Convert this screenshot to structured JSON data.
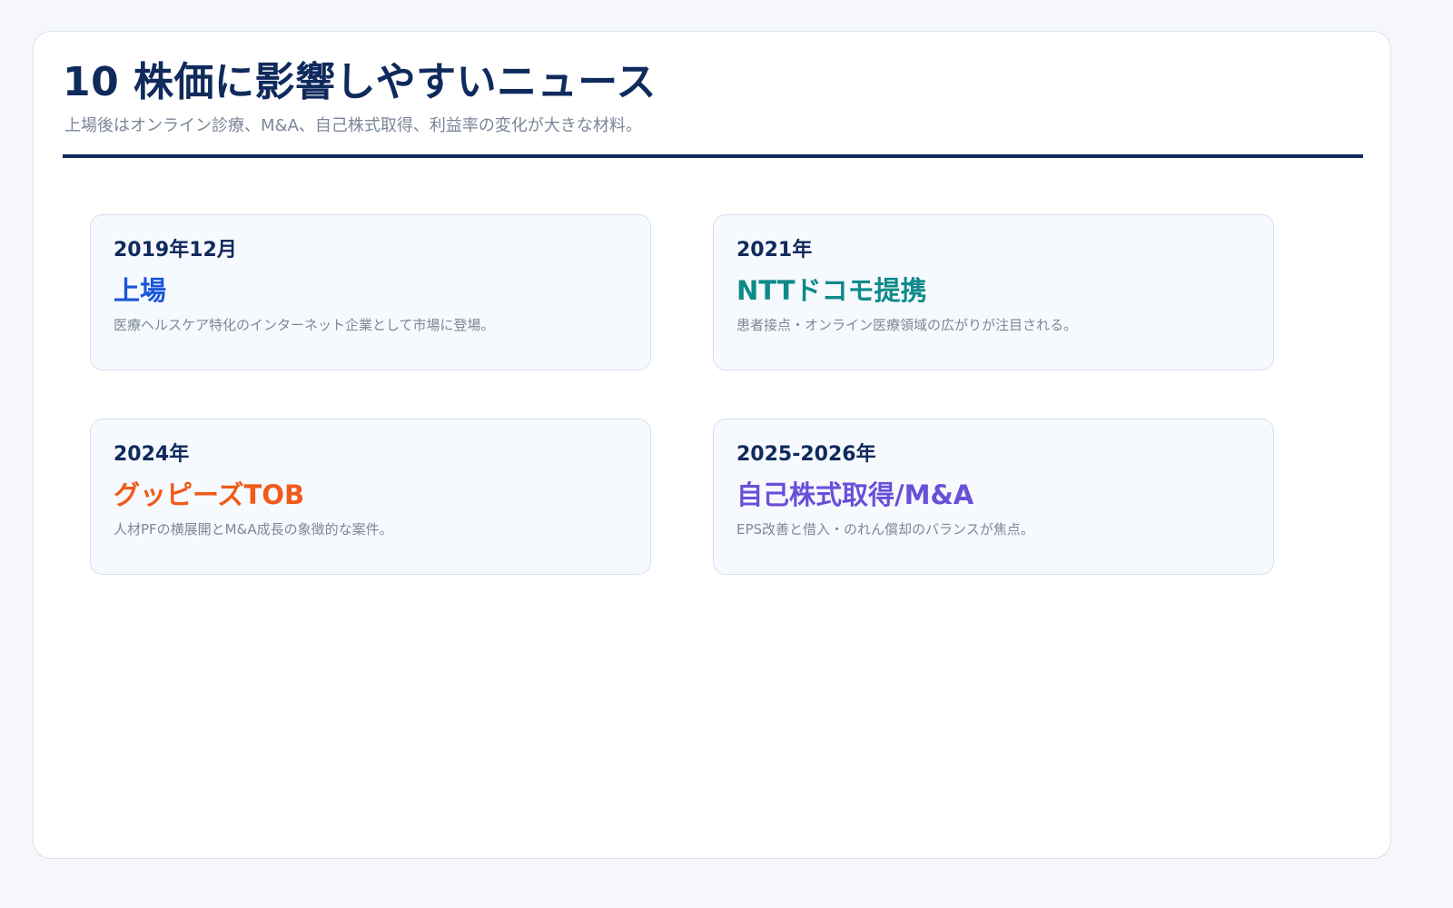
{
  "header": {
    "title": "10 株価に影響しやすいニュース",
    "subtitle": "上場後はオンライン診療、M&A、自己株式取得、利益率の変化が大きな材料。"
  },
  "colors": {
    "title": "#0f2a5c",
    "rule": "#0f2a5c",
    "card_background": "#f6f9fe",
    "card_border": "#d6e0ec",
    "description": "#7d8898"
  },
  "cards": [
    {
      "date": "2019年12月",
      "headline": "上場",
      "description": "医療ヘルスケア特化のインターネット企業として市場に登場。",
      "accent": "#1a56db"
    },
    {
      "date": "2021年",
      "headline": "NTTドコモ提携",
      "description": "患者接点・オンライン医療領域の広がりが注目される。",
      "accent": "#0e8a8a"
    },
    {
      "date": "2024年",
      "headline": "グッピーズTOB",
      "description": "人材PFの横展開とM&A成長の象徴的な案件。",
      "accent": "#f05a1a"
    },
    {
      "date": "2025-2026年",
      "headline": "自己株式取得/M&A",
      "description": "EPS改善と借入・のれん償却のバランスが焦点。",
      "accent": "#6a4fd8"
    }
  ]
}
